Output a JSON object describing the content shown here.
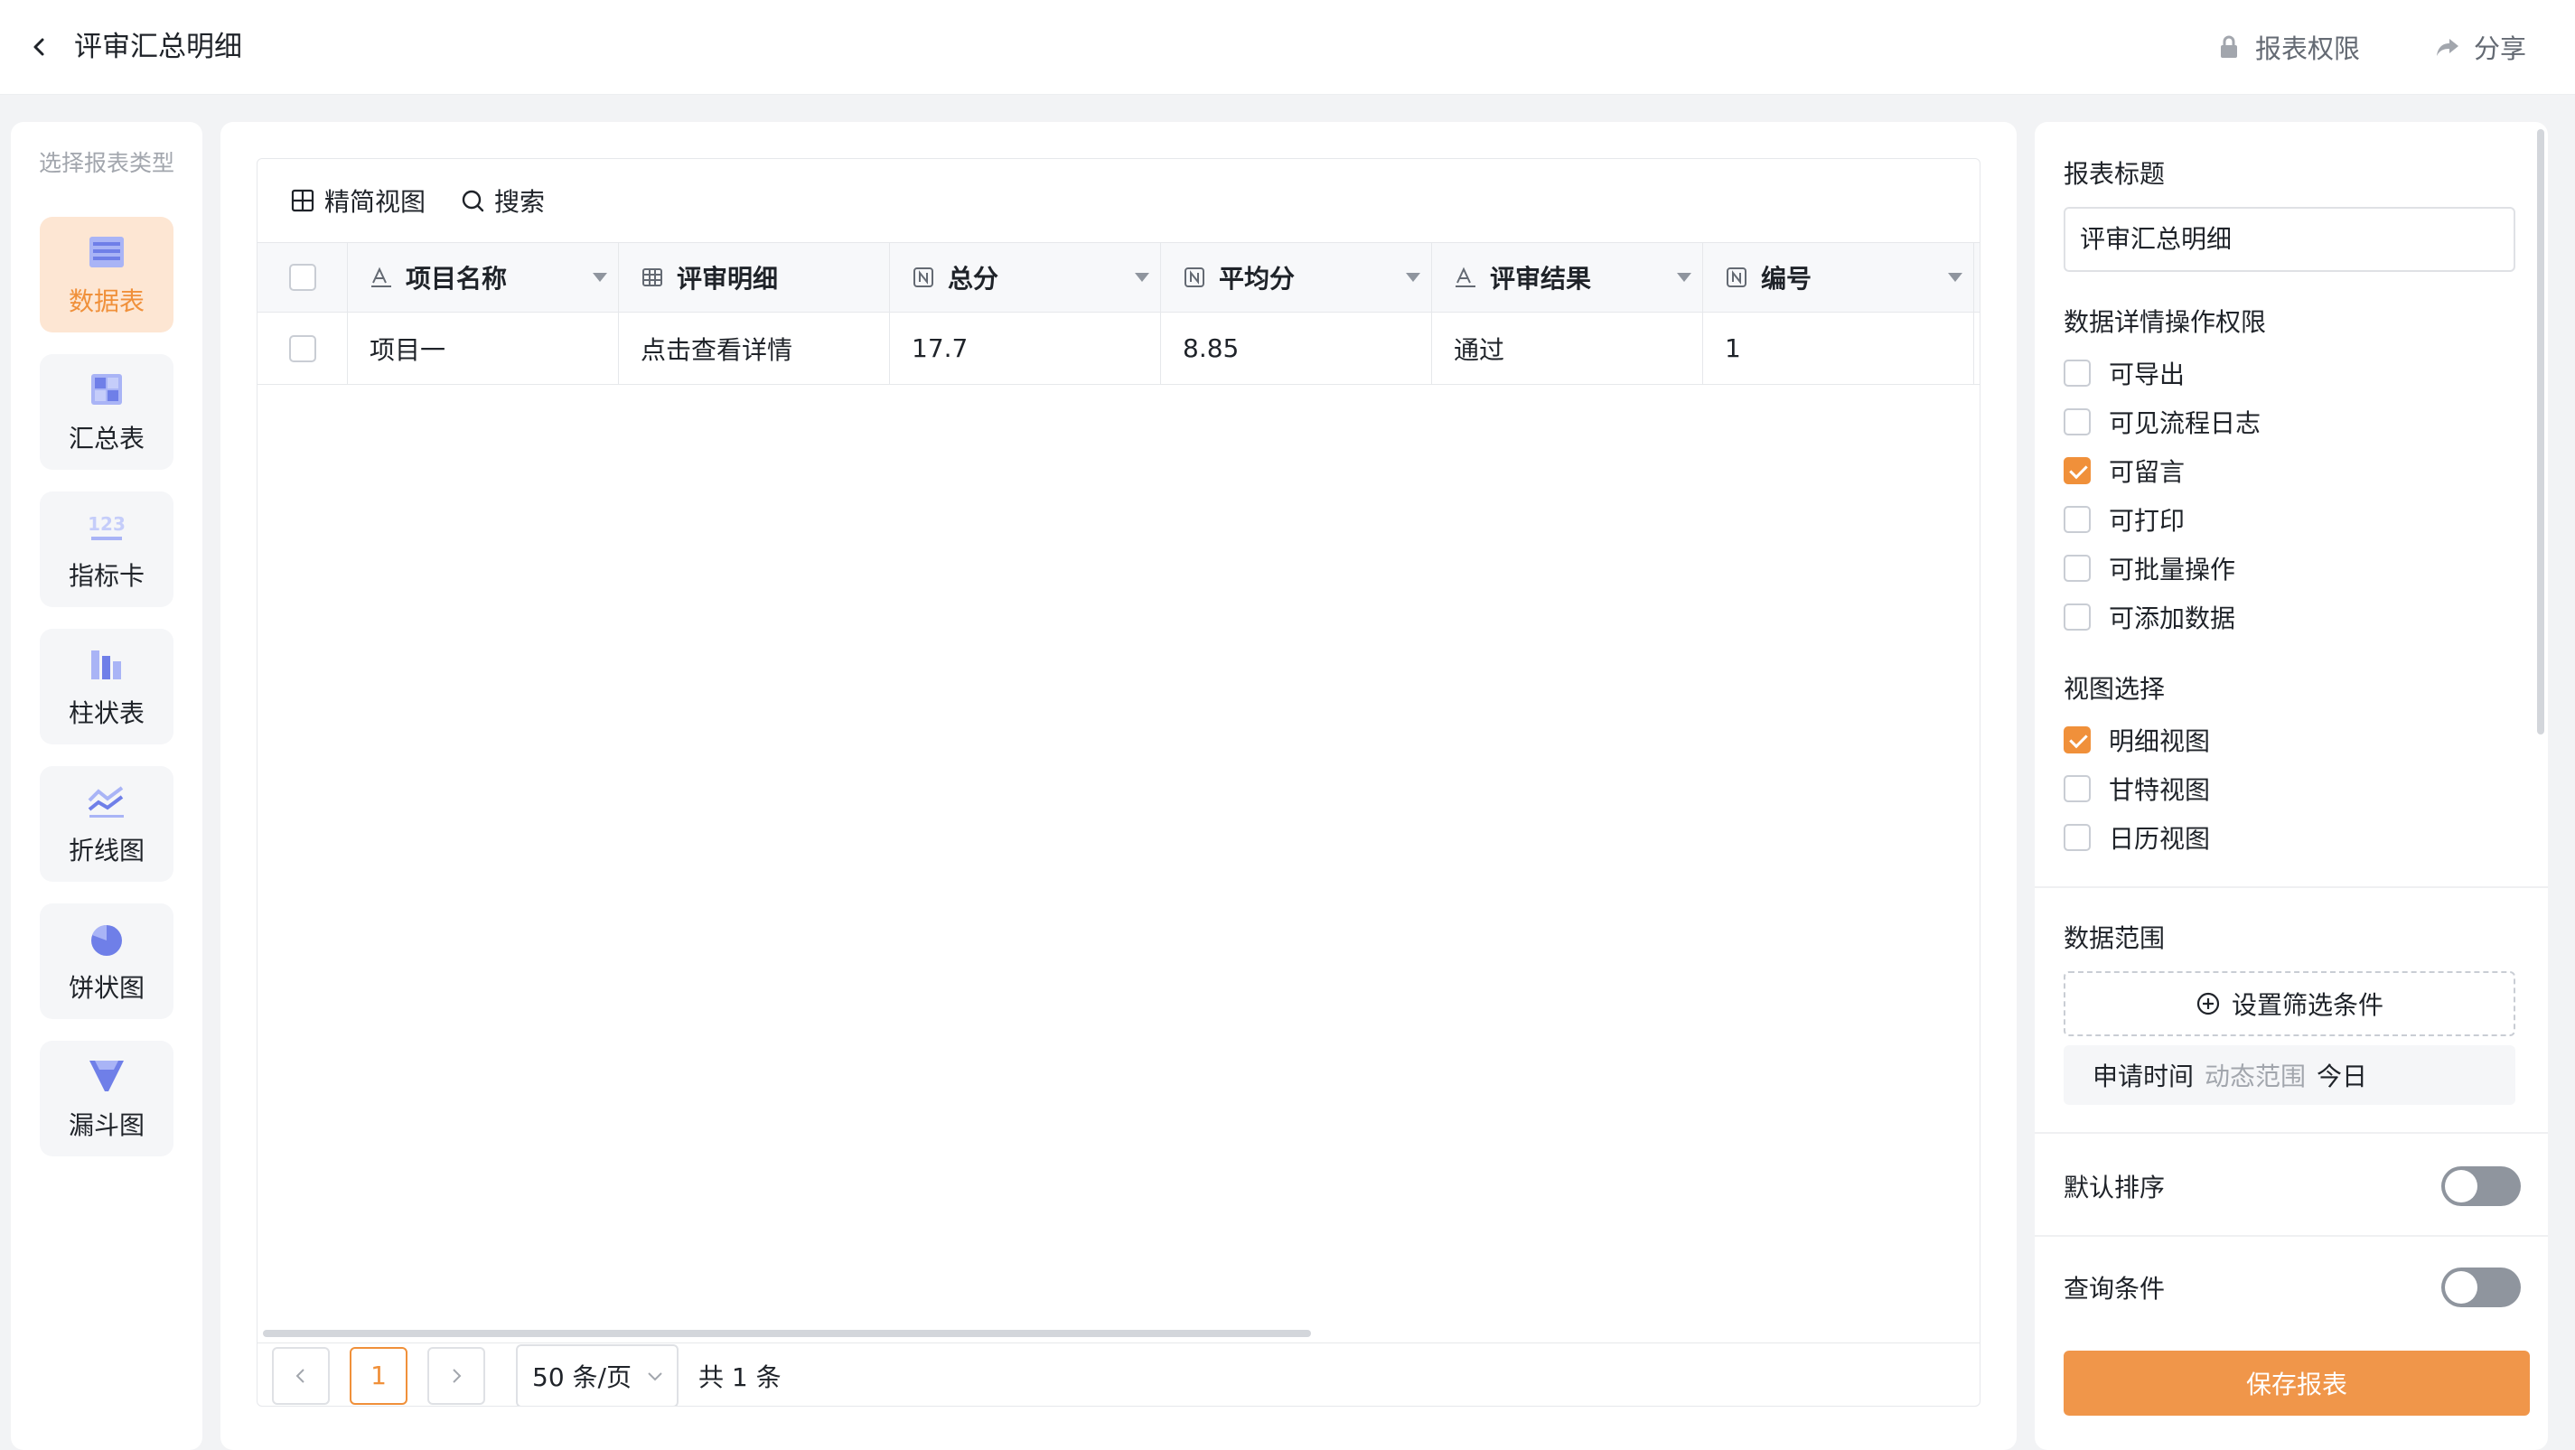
{
  "header": {
    "title": "评审汇总明细",
    "report_permission_label": "报表权限",
    "share_label": "分享"
  },
  "type_panel": {
    "heading": "选择报表类型",
    "items": [
      {
        "label": "数据表",
        "icon": "table-icon",
        "active": true
      },
      {
        "label": "汇总表",
        "icon": "summary-table-icon",
        "active": false
      },
      {
        "label": "指标卡",
        "icon": "number-card-icon",
        "active": false
      },
      {
        "label": "柱状表",
        "icon": "bar-chart-icon",
        "active": false
      },
      {
        "label": "折线图",
        "icon": "line-chart-icon",
        "active": false
      },
      {
        "label": "饼状图",
        "icon": "pie-chart-icon",
        "active": false
      },
      {
        "label": "漏斗图",
        "icon": "funnel-chart-icon",
        "active": false
      }
    ],
    "active_color": "#f0903a"
  },
  "table": {
    "toolbar": {
      "compact_view_label": "精简视图",
      "search_label": "搜索"
    },
    "columns": [
      {
        "label": "项目名称",
        "icon": "text-field-icon"
      },
      {
        "label": "评审明细",
        "icon": "subtable-field-icon"
      },
      {
        "label": "总分",
        "icon": "number-field-icon"
      },
      {
        "label": "平均分",
        "icon": "number-field-icon"
      },
      {
        "label": "评审结果",
        "icon": "text-field-icon"
      },
      {
        "label": "编号",
        "icon": "number-field-icon"
      }
    ],
    "rows": [
      [
        "项目一",
        "点击查看详情",
        "17.7",
        "8.85",
        "通过",
        "1"
      ]
    ],
    "pagination": {
      "current_page": "1",
      "page_size": "50 条/页",
      "total": "共 1 条"
    }
  },
  "settings": {
    "report_title_label": "报表标题",
    "report_title_value": "评审汇总明细",
    "permissions_label": "数据详情操作权限",
    "permissions": [
      {
        "label": "可导出",
        "checked": false
      },
      {
        "label": "可见流程日志",
        "checked": false
      },
      {
        "label": "可留言",
        "checked": true
      },
      {
        "label": "可打印",
        "checked": false
      },
      {
        "label": "可批量操作",
        "checked": false
      },
      {
        "label": "可添加数据",
        "checked": false
      }
    ],
    "view_label": "视图选择",
    "views": [
      {
        "label": "明细视图",
        "checked": true
      },
      {
        "label": "甘特视图",
        "checked": false
      },
      {
        "label": "日历视图",
        "checked": false
      }
    ],
    "data_range_label": "数据范围",
    "filter_button_label": "设置筛选条件",
    "filter_tag": {
      "field": "申请时间",
      "mode": "动态范围",
      "value": "今日"
    },
    "default_sort_label": "默认排序",
    "query_conditions_label": "查询条件",
    "save_label": "保存报表",
    "accent_color": "#f0903a"
  }
}
